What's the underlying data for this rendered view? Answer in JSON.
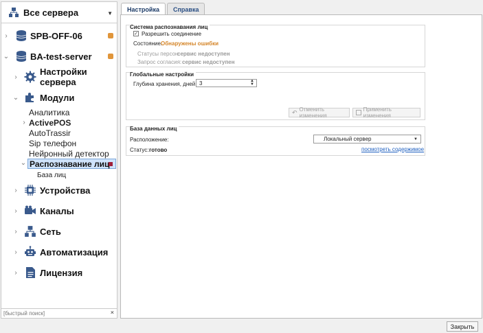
{
  "sidebar": {
    "server_select": "Все сервера",
    "tree": [
      {
        "label": "SPB-OFF-06"
      },
      {
        "label": "BA-test-server"
      },
      {
        "label": "Настройки сервера"
      },
      {
        "label": "Модули"
      },
      {
        "label": "Аналитика"
      },
      {
        "label": "ActivePOS"
      },
      {
        "label": "AutoTrassir"
      },
      {
        "label": "Sip телефон"
      },
      {
        "label": "Нейронный детектор"
      },
      {
        "label": "Распознавание лиц"
      },
      {
        "label": "База лиц"
      },
      {
        "label": "Устройства"
      },
      {
        "label": "Каналы"
      },
      {
        "label": "Сеть"
      },
      {
        "label": "Автоматизация"
      },
      {
        "label": "Лицензия"
      }
    ],
    "search_placeholder": "[быстрый поиск]",
    "search_clear": "×"
  },
  "tabs": [
    {
      "label": "Настройка"
    },
    {
      "label": "Справка"
    }
  ],
  "face_system": {
    "title": "Система распознавания лиц",
    "allow_connection": "Разрешить соединение",
    "allow_checked": true,
    "state_label": "Состояние:",
    "state_value": "Обнаружены ошибки",
    "persons_status_label": "Статусы персон:",
    "persons_status_value": "сервис недоступен",
    "consent_label": "Запрос согласия:",
    "consent_value": "сервис недоступен"
  },
  "global_settings": {
    "title": "Глобальные настройки",
    "depth_label": "Глубина хранения, дней",
    "depth_value": "3",
    "cancel_button": "Отменить изменения",
    "apply_button": "Применить изменения"
  },
  "face_db": {
    "title": "База данных лиц",
    "location_label": "Расположение:",
    "location_value": "Локальный сервер",
    "status_label": "Статус:",
    "status_value": "готово",
    "view_link": "посмотреть содержимое"
  },
  "footer": {
    "close_button": "Закрыть"
  },
  "colors": {
    "accent": "#2a4f84",
    "error_orange": "#d5862a",
    "selection": "#cfe3fb",
    "marker_red": "#a0203a"
  }
}
